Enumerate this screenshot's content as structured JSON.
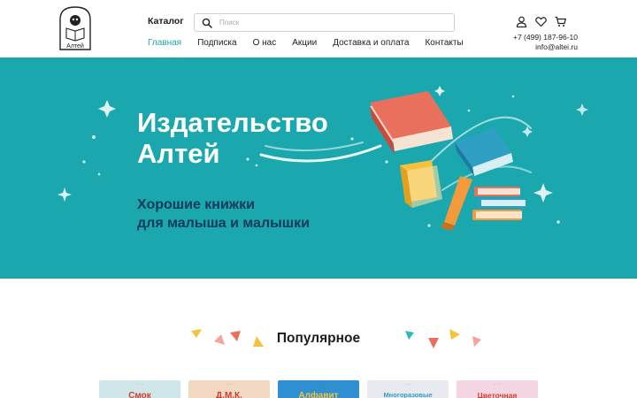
{
  "header": {
    "logo_text": "Алтей",
    "catalog_label": "Каталог",
    "search": {
      "placeholder": "Поиск",
      "value": ""
    },
    "nav": [
      {
        "label": "Главная",
        "active": true
      },
      {
        "label": "Подписка",
        "active": false
      },
      {
        "label": "О нас",
        "active": false
      },
      {
        "label": "Акции",
        "active": false
      },
      {
        "label": "Доставка и оплата",
        "active": false
      },
      {
        "label": "Контакты",
        "active": false
      }
    ],
    "icons": [
      "user-icon",
      "heart-icon",
      "cart-icon"
    ],
    "phone": "+7 (499) 187-96-10",
    "email": "info@altei.ru"
  },
  "hero": {
    "title_line1": "Издательство",
    "title_line2": "Алтей",
    "subtitle_line1": "Хорошие книжки",
    "subtitle_line2": "для малыша и малышки"
  },
  "popular": {
    "title": "Популярное",
    "books": [
      {
        "title": "Смок",
        "bg": "#cfe7e9"
      },
      {
        "title": "Д.М.К.",
        "bg": "#f3d9c4"
      },
      {
        "title": "Алфавит",
        "bg": "#2f8fd0"
      },
      {
        "title": "Многоразовые",
        "bg": "#e9eaf0"
      },
      {
        "title": "Цветочная",
        "bg": "#f4d6e4"
      }
    ]
  },
  "colors": {
    "brand_teal": "#1aa7ad",
    "nav_active": "#1aa7ad",
    "hero_subtitle": "#113a5c",
    "book_red": "#e8705c",
    "book_blue": "#2f9fc4",
    "book_yellow": "#f6c23e",
    "book_orange": "#f39a3d"
  }
}
